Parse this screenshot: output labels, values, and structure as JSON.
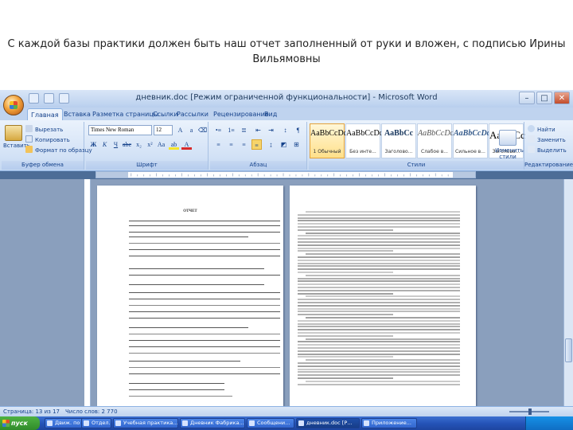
{
  "caption": "С каждой базы практики должен быть наш отчет заполненный от руки и вложен, с подписью Ирины Вильямовны",
  "window": {
    "title": "дневник.doc [Режим ограниченной функциональности] - Microsoft Word"
  },
  "tabs": [
    "Главная",
    "Вставка",
    "Разметка страницы",
    "Ссылки",
    "Рассылки",
    "Рецензирование",
    "Вид"
  ],
  "clipboard": {
    "paste": "Вставить",
    "cut": "Вырезать",
    "copy": "Копировать",
    "format_painter": "Формат по образцу",
    "label": "Буфер обмена"
  },
  "font": {
    "name": "Times New Roman",
    "size": "12",
    "label": "Шрифт"
  },
  "paragraph": {
    "label": "Абзац"
  },
  "styles": {
    "label": "Стили",
    "items": [
      {
        "sample": "AaBbCcDc",
        "name": "1 Обычный"
      },
      {
        "sample": "AaBbCcDc",
        "name": "Без инте..."
      },
      {
        "sample": "AaBbCc",
        "name": "Заголово..."
      },
      {
        "sample": "AaBbCcDc",
        "name": "Слабое в..."
      },
      {
        "sample": "AaBbCcDc",
        "name": "Сильное в..."
      },
      {
        "sample": "AaBbCc",
        "name": "Заголово..."
      }
    ],
    "change_styles": "Изменить стили"
  },
  "editing": {
    "find": "Найти",
    "replace": "Заменить",
    "select": "Выделить",
    "label": "Редактирование"
  },
  "document": {
    "page1_title": "ОТЧЕТ"
  },
  "status": {
    "page": "Страница: 13 из 17",
    "words": "Число слов: 2 770"
  },
  "taskbar": {
    "start": "пуск",
    "items": [
      "Движ. по ...",
      "Отдел...",
      "Учебная практика...",
      "Дневник Фабрика...",
      "Сообщени...",
      "дневник.doc [Р...",
      "Приложение..."
    ]
  }
}
